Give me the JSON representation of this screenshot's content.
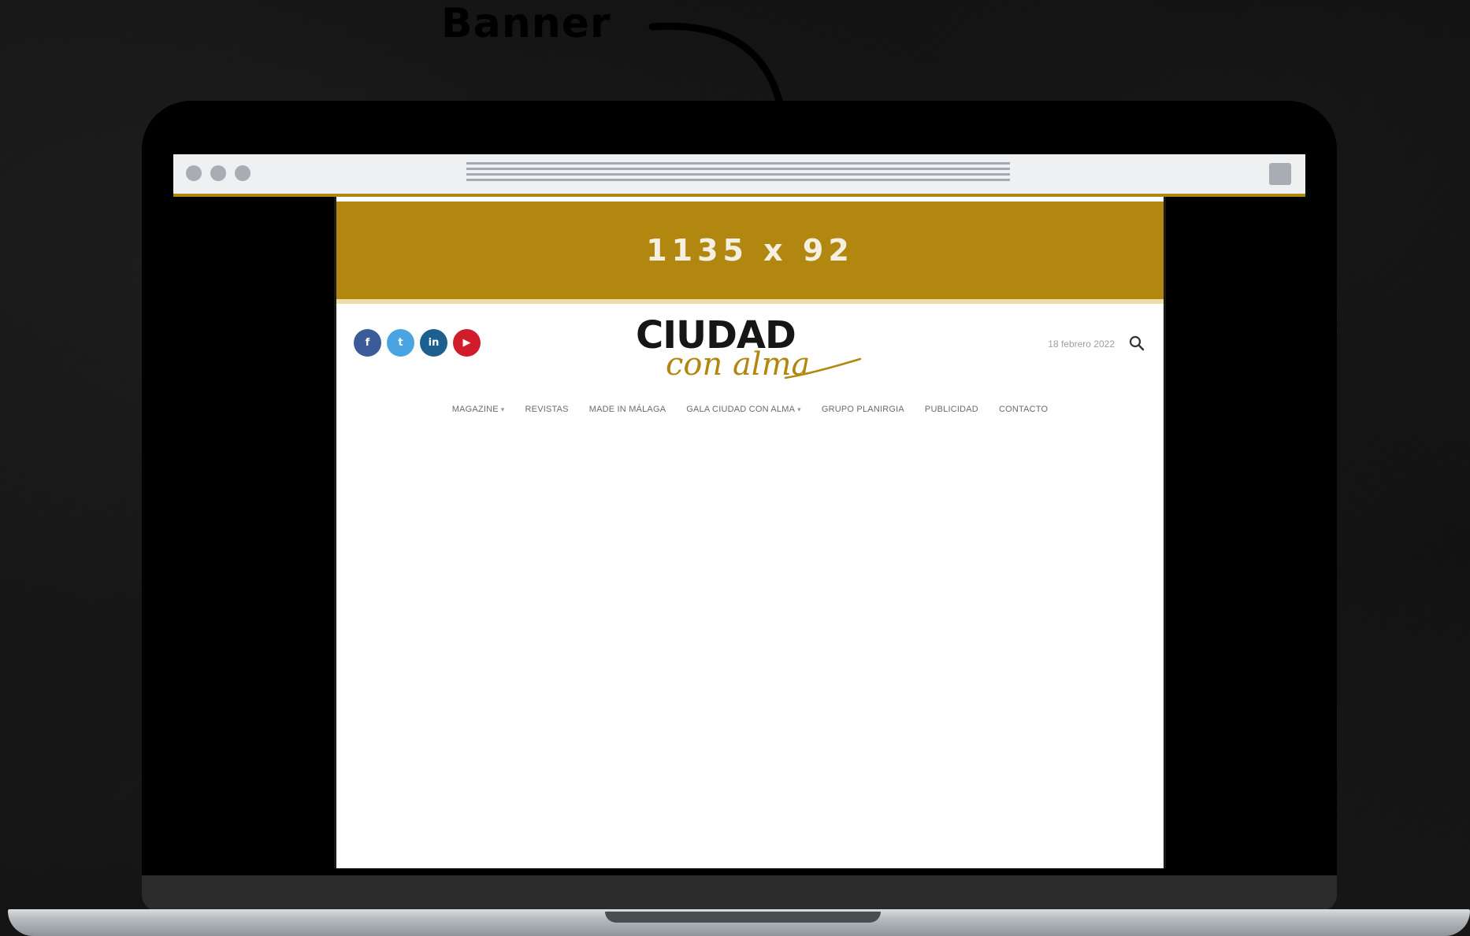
{
  "callout": {
    "label": "Banner"
  },
  "browser": {
    "tabs_dots": 3
  },
  "banner": {
    "text": "1135 x 92"
  },
  "social": [
    {
      "name": "facebook",
      "glyph": "f",
      "color": "#3b5b99"
    },
    {
      "name": "twitter",
      "glyph": "t",
      "color": "#4aa3e2"
    },
    {
      "name": "linkedin",
      "glyph": "in",
      "color": "#1d5f8e"
    },
    {
      "name": "youtube",
      "glyph": "▶",
      "color": "#d11c2b"
    }
  ],
  "logo": {
    "main": "CIUDAD",
    "script": "con alma"
  },
  "header": {
    "date": "18 febrero 2022"
  },
  "nav": [
    {
      "label": "MAGAZINE",
      "has_dropdown": true,
      "dropdown_glyph": "▾"
    },
    {
      "label": "REVISTAS"
    },
    {
      "label": "MADE IN MÁLAGA"
    },
    {
      "label": "GALA CIUDAD CON ALMA",
      "has_dropdown": true,
      "dropdown_glyph": "▾"
    },
    {
      "label": "GRUPO PLANIRGIA"
    },
    {
      "label": "PUBLICIDAD"
    },
    {
      "label": "CONTACTO"
    }
  ],
  "colors": {
    "accent": "#b2870f",
    "banner_text": "#f4efe1",
    "background": "#0c0c0c"
  }
}
